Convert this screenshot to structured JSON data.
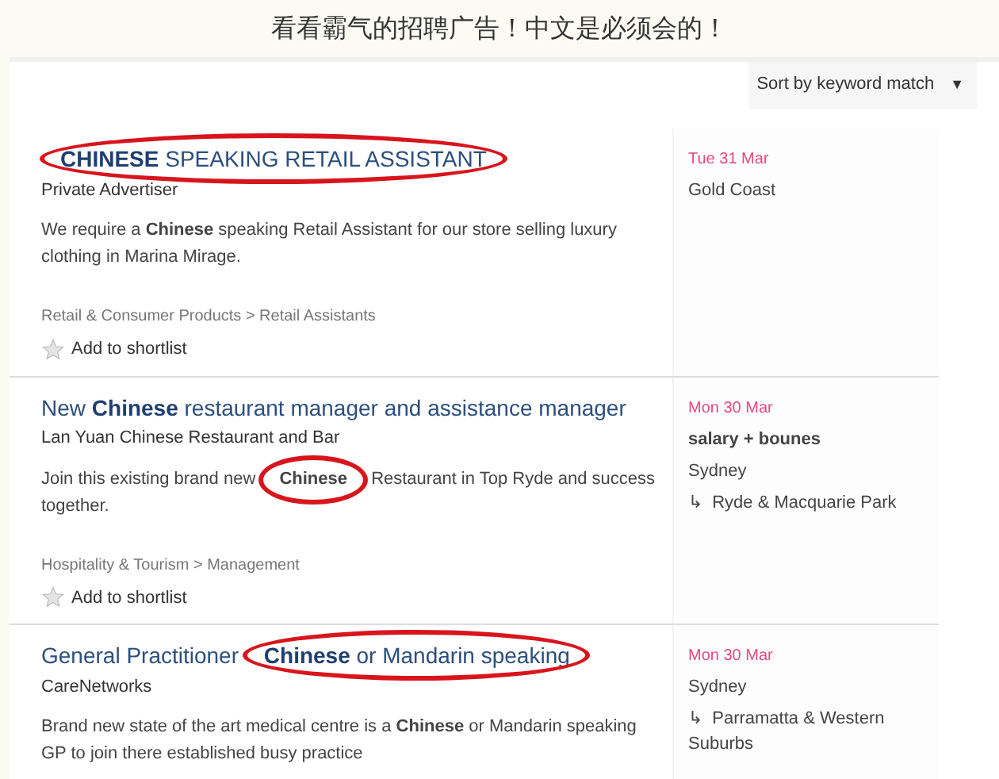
{
  "caption": "看看霸气的招聘广告！中文是必须会的！",
  "sort": {
    "label": "Sort by keyword match",
    "caret": "▼"
  },
  "jobs": [
    {
      "title": [
        {
          "text": "**CHINESE** SPEAKING RETAIL ASSISTANT",
          "circled": true
        }
      ],
      "company": "Private Advertiser",
      "description": [
        {
          "text": "We require a **Chinese** speaking Retail Assistant for our store selling luxury clothing in Marina Mirage.",
          "circled": false
        }
      ],
      "category": "Retail & Consumer Products > Retail Assistants",
      "shortlist": "Add to shortlist",
      "date": "Tue 31 Mar",
      "location": "Gold Coast"
    },
    {
      "title": [
        {
          "text": "New **Chinese** restaurant manager and assistance manager",
          "circled": false
        }
      ],
      "company": "Lan Yuan Chinese Restaurant and Bar",
      "description": [
        {
          "text": "Join this existing brand new",
          "circled": false
        },
        {
          "text": "**Chinese**",
          "circled": true
        },
        {
          "text": "Restaurant in Top Ryde and success together.",
          "circled": false
        }
      ],
      "category": "Hospitality & Tourism > Management",
      "shortlist": "Add to shortlist",
      "date": "Mon 30 Mar",
      "salary": "salary + bounes",
      "location": "Sydney",
      "area": "↳  Ryde & Macquarie Park"
    },
    {
      "title": [
        {
          "text": "General Practitioner",
          "circled": false
        },
        {
          "text": "**Chinese** or Mandarin speaking",
          "circled": true
        }
      ],
      "company": "CareNetworks",
      "description": [
        {
          "text": "Brand new state of the art medical centre is a **Chinese** or Mandarin speaking GP to join there established busy practice",
          "circled": false
        }
      ],
      "date": "Mon 30 Mar",
      "location": "Sydney",
      "area": "↳  Parramatta & Western Suburbs"
    }
  ]
}
